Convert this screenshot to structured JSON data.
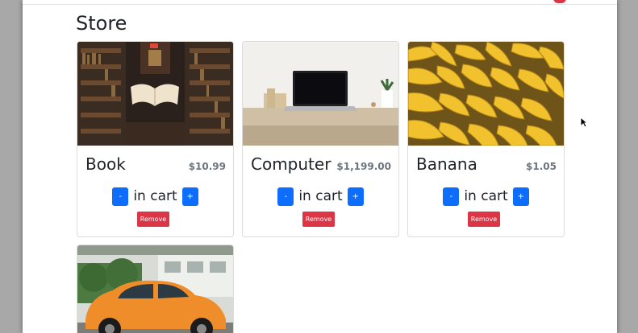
{
  "page": {
    "title": "Store"
  },
  "products": [
    {
      "name": "Book",
      "price": "$10.99",
      "in_cart_label": "in cart",
      "minus_label": "-",
      "plus_label": "+",
      "remove_label": "Remove"
    },
    {
      "name": "Computer",
      "price": "$1,199.00",
      "in_cart_label": "in cart",
      "minus_label": "-",
      "plus_label": "+",
      "remove_label": "Remove"
    },
    {
      "name": "Banana",
      "price": "$1.05",
      "in_cart_label": "in cart",
      "minus_label": "-",
      "plus_label": "+",
      "remove_label": "Remove"
    }
  ],
  "colors": {
    "primary": "#0d6efd",
    "danger": "#dc3545",
    "muted": "#6c757d"
  }
}
